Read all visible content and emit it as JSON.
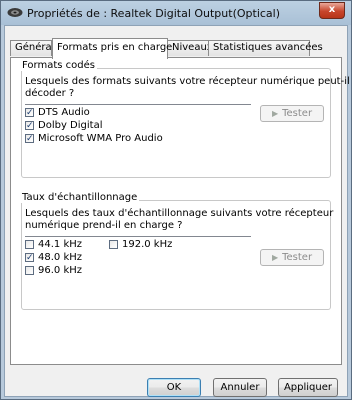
{
  "window": {
    "title": "Propriétés de : Realtek Digital Output(Optical)",
    "close_symbol": "x"
  },
  "tabs": [
    {
      "label": "Général"
    },
    {
      "label": "Formats pris en charge"
    },
    {
      "label": "Niveaux"
    },
    {
      "label": "Statistiques avancées"
    }
  ],
  "formats": {
    "title": "Formats codés",
    "description_line1": "Lesquels des formats suivants votre récepteur numérique peut-il",
    "description_line2": "décoder ?",
    "items": [
      {
        "label": "DTS Audio",
        "checked": "✓"
      },
      {
        "label": "Dolby Digital",
        "checked": "✓"
      },
      {
        "label": "Microsoft WMA Pro Audio",
        "checked": "✓"
      }
    ],
    "test_button": "Tester"
  },
  "sample_rates": {
    "title": "Taux d'échantillonnage",
    "description_line1": "Lesquels des taux d'échantillonnage suivants votre récepteur",
    "description_line2": "numérique prend-il en charge ?",
    "items": [
      {
        "label": "44.1 kHz",
        "checked": ""
      },
      {
        "label": "48.0 kHz",
        "checked": "✓"
      },
      {
        "label": "96.0 kHz",
        "checked": ""
      },
      {
        "label": "192.0 kHz",
        "checked": ""
      }
    ],
    "test_button": "Tester"
  },
  "buttons": {
    "ok": "OK",
    "cancel": "Annuler",
    "apply": "Appliquer"
  }
}
